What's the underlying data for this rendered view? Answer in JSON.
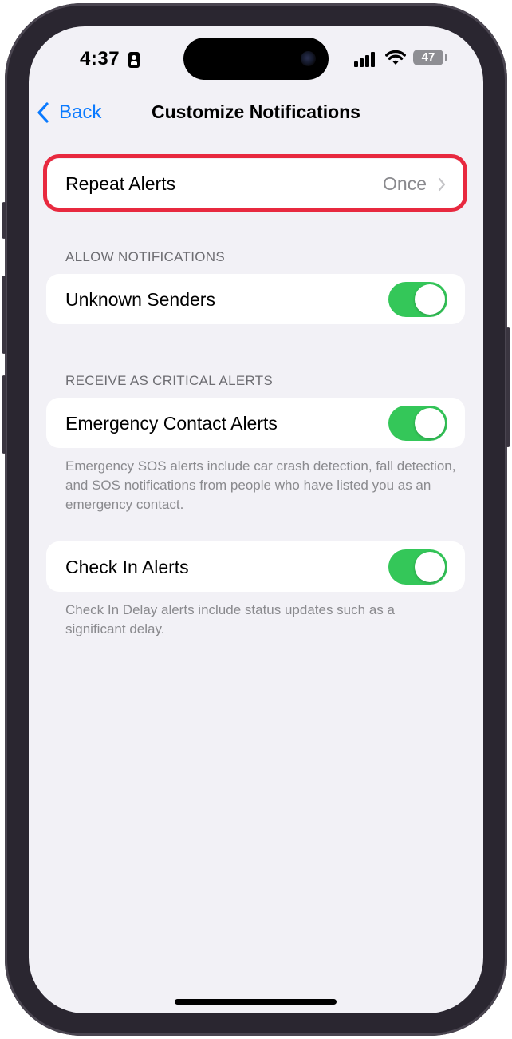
{
  "status_bar": {
    "time": "4:37",
    "battery": "47",
    "icons": [
      "id-card-icon",
      "cellular-signal-icon",
      "wifi-icon",
      "battery-icon"
    ]
  },
  "nav": {
    "back_label": "Back",
    "title": "Customize Notifications"
  },
  "repeat_alerts": {
    "label": "Repeat Alerts",
    "value": "Once"
  },
  "allow_notifications": {
    "header": "ALLOW NOTIFICATIONS",
    "items": [
      {
        "label": "Unknown Senders",
        "on": true
      }
    ]
  },
  "critical_alerts": {
    "header": "RECEIVE AS CRITICAL ALERTS",
    "items": [
      {
        "label": "Emergency Contact Alerts",
        "on": true
      }
    ],
    "footer": "Emergency SOS alerts include car crash detection, fall detection, and SOS notifications from people who have listed you as an emergency contact."
  },
  "check_in": {
    "items": [
      {
        "label": "Check In Alerts",
        "on": true
      }
    ],
    "footer": "Check In Delay alerts include status updates such as a significant delay."
  },
  "colors": {
    "accent": "#0a7aff",
    "toggle_on": "#34c759",
    "highlight": "#e8293f",
    "background": "#f2f1f6"
  }
}
